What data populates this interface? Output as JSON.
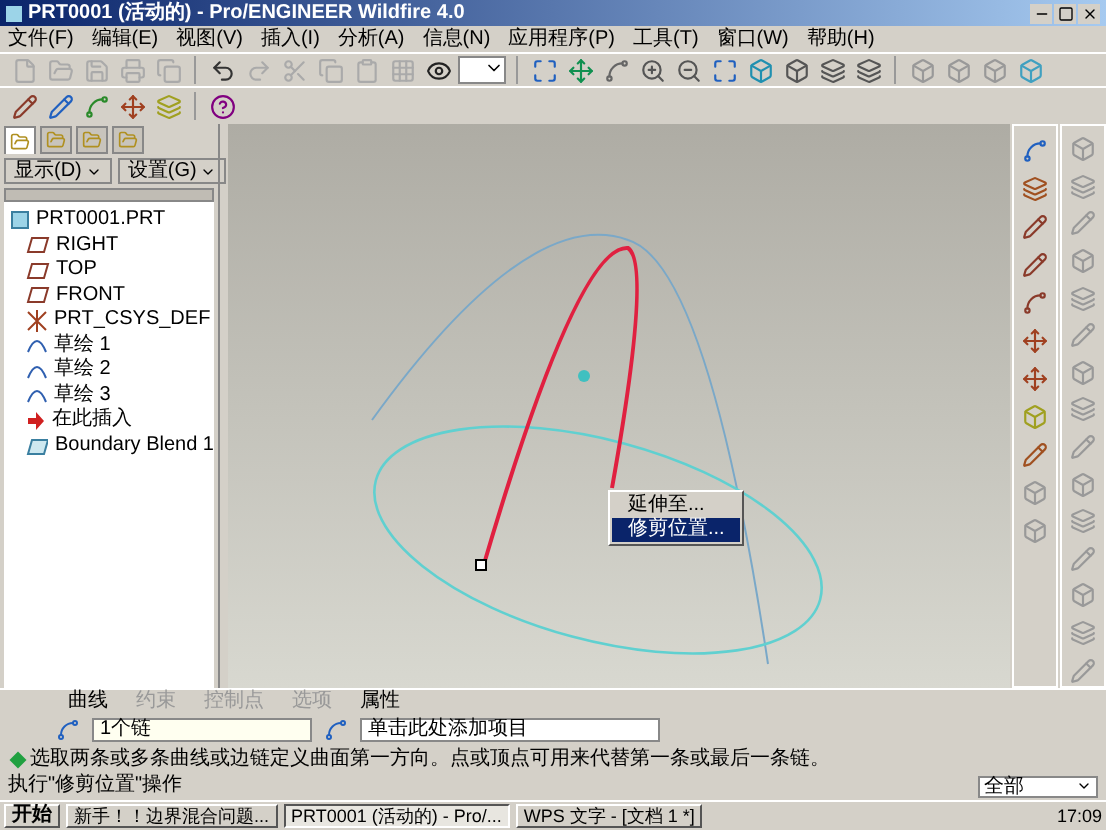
{
  "window": {
    "title": "PRT0001 (活动的) - Pro/ENGINEER Wildfire 4.0"
  },
  "menu": [
    "文件(F)",
    "编辑(E)",
    "视图(V)",
    "插入(I)",
    "分析(A)",
    "信息(N)",
    "应用程序(P)",
    "工具(T)",
    "窗口(W)",
    "帮助(H)"
  ],
  "tree_tabs": [
    {
      "selected": true
    },
    {
      "selected": false
    },
    {
      "selected": false
    },
    {
      "selected": false
    }
  ],
  "tree_toolbar": [
    "显示(D)",
    "设置(G)"
  ],
  "tree": [
    {
      "label": "PRT0001.PRT",
      "kind": "part",
      "children": [
        {
          "label": "RIGHT",
          "kind": "plane"
        },
        {
          "label": "TOP",
          "kind": "plane"
        },
        {
          "label": "FRONT",
          "kind": "plane"
        },
        {
          "label": "PRT_CSYS_DEF",
          "kind": "csys"
        },
        {
          "label": "草绘 1",
          "kind": "sketch"
        },
        {
          "label": "草绘 2",
          "kind": "sketch"
        },
        {
          "label": "草绘 3",
          "kind": "sketch"
        },
        {
          "label": "在此插入",
          "kind": "insert"
        },
        {
          "label": "Boundary Blend 1",
          "kind": "blend"
        }
      ]
    }
  ],
  "context_menu": [
    {
      "label": "延伸至...",
      "selected": false
    },
    {
      "label": "修剪位置...",
      "selected": true
    }
  ],
  "dashboard": {
    "tabs": [
      {
        "label": "曲线",
        "disabled": false
      },
      {
        "label": "约束",
        "disabled": true
      },
      {
        "label": "控制点",
        "disabled": true
      },
      {
        "label": "选项",
        "disabled": true
      },
      {
        "label": "属性",
        "disabled": false
      }
    ],
    "first_direction": "1个链",
    "second_direction": "单击此处添加项目",
    "message": "选取两条或多条曲线或边链定义曲面第一方向。点或顶点可用来代替第一条或最后一条链。"
  },
  "status_bar": "执行\"修剪位置\"操作",
  "filter": "全部",
  "taskbar": {
    "start": "开始",
    "tasks": [
      {
        "label": "新手！！边界混合问题...",
        "selected": false
      },
      {
        "label": "PRT0001 (活动的) - Pro/...",
        "selected": true
      },
      {
        "label": "WPS 文字 - [文档 1 *]",
        "selected": false
      }
    ],
    "clock": "17:09"
  }
}
